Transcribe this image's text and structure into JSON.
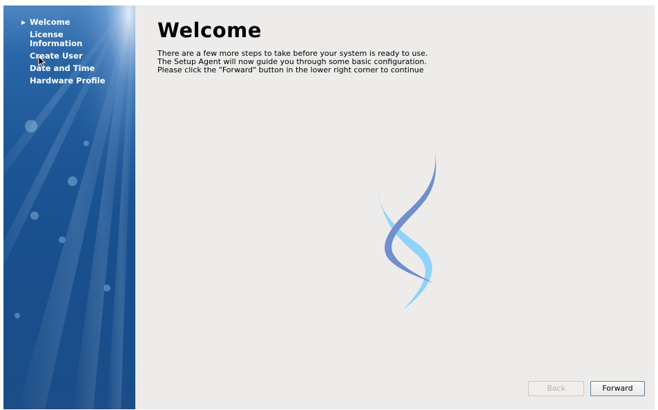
{
  "sidebar": {
    "items": [
      {
        "label": "Welcome",
        "active": true
      },
      {
        "label": "License Information",
        "active": false
      },
      {
        "label": "Create User",
        "active": false
      },
      {
        "label": "Date and Time",
        "active": false
      },
      {
        "label": "Hardware Profile",
        "active": false
      }
    ],
    "active_marker_icon": "triangle-right-icon"
  },
  "main": {
    "title": "Welcome",
    "intro_lines": [
      "There are a few more steps to take before your system is ready to use.",
      "The Setup Agent will now guide you through some basic configuration.",
      "Please click the \"Forward\" button in the lower right corner to continue"
    ],
    "logo_icon": "distribution-logo-icon"
  },
  "buttons": {
    "back_label": "Back",
    "back_enabled": false,
    "forward_label": "Forward"
  },
  "colors": {
    "sidebar_blue": "#1d5797",
    "content_background": "#edeceb",
    "logo_dark": "#6f8fcd",
    "logo_light": "#8fd3fa"
  }
}
